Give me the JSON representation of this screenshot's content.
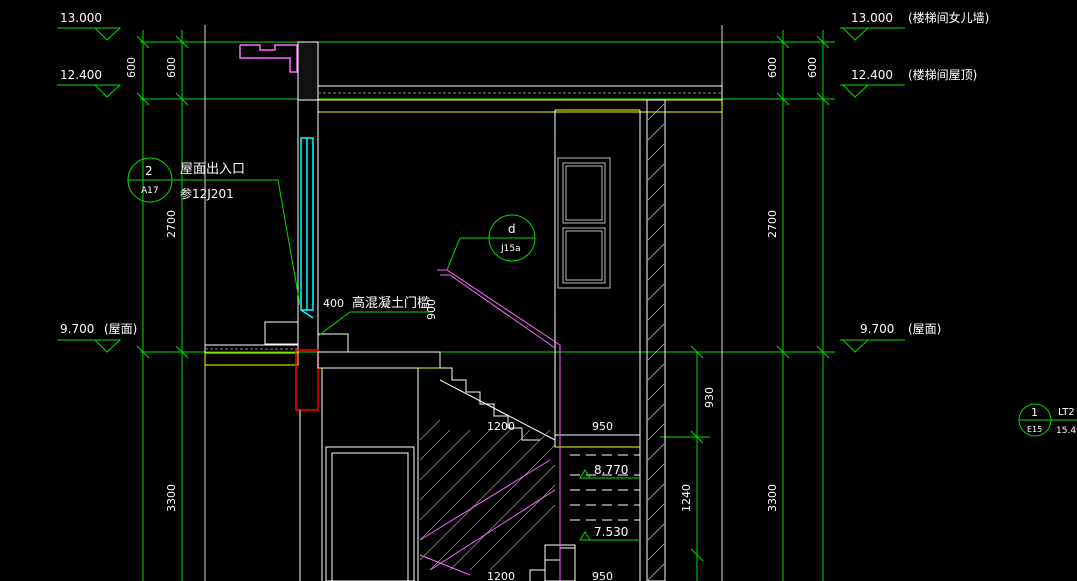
{
  "levels": {
    "l13000": {
      "value": "13.000",
      "note": "(楼梯间女儿墙)"
    },
    "l12400": {
      "value": "12.400",
      "note": "(楼梯间屋顶)"
    },
    "l9700": {
      "value": "9.700",
      "note": "(屋面)"
    }
  },
  "dims": {
    "d600": "600",
    "d2700": "2700",
    "d3300": "3300",
    "d400": "400",
    "d900": "900",
    "d930": "930",
    "d1240": "1240",
    "d1200": "1200",
    "d950": "950"
  },
  "landings": {
    "l8770": "8.770",
    "l7530": "7.530"
  },
  "callouts": {
    "roof_entry": {
      "num": "2",
      "sheet": "A17",
      "line1": "屋面出入口",
      "line2": "参12J201"
    },
    "detail_d": {
      "num": "d",
      "sheet": "J15a"
    },
    "stair_ref": {
      "num": "1",
      "sheet": "E15",
      "code": "LT2",
      "elev": "15.4"
    }
  },
  "notes": {
    "concrete_sill": "高混凝土门槛"
  },
  "colors": {
    "background": "#000000",
    "dim": "#00ff00",
    "text": "#ffffff",
    "wall": "#ffffff",
    "concrete": "#ffff00",
    "handrail": "#ff66ff",
    "window": "#00ffff",
    "hatch": "#c8c8c8"
  }
}
